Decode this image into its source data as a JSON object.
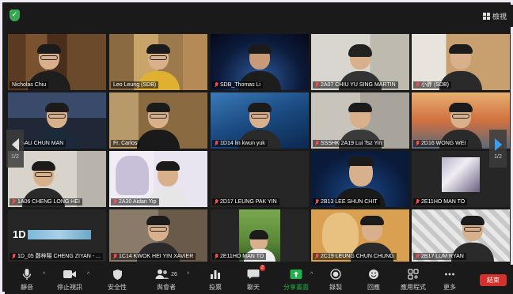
{
  "topbar": {
    "view_label": "檢視"
  },
  "pagination": {
    "left": "1/2",
    "right": "1/2"
  },
  "tiles": [
    {
      "name": "Nicholas Chiu",
      "muted": false
    },
    {
      "name": "Leo Leung (SDB)",
      "muted": false
    },
    {
      "name": "SDB_Thomas Li",
      "muted": true
    },
    {
      "name": "2A07 CHIU YU SING MARTIN",
      "muted": true
    },
    {
      "name": "小胖 (SDB)",
      "muted": true
    },
    {
      "name": "TSAU CHUN MAN",
      "muted": true
    },
    {
      "name": "Fr. Carlos",
      "muted": false
    },
    {
      "name": "1D14 lin kwun yuk",
      "muted": true
    },
    {
      "name": "SSSHK 2A19 Lui Tsz Yin",
      "muted": true
    },
    {
      "name": "2D16 WONG WEI",
      "muted": true
    },
    {
      "name": "1A06 CHENG LONG HEI",
      "muted": true
    },
    {
      "name": "2A30 Aidan Yip",
      "muted": true
    },
    {
      "name": "2D17 LEUNG PAK YIN",
      "muted": true
    },
    {
      "name": "2B13 LEE SHUN CHIT",
      "muted": true
    },
    {
      "name": "2E11HO MAN TO",
      "muted": true
    },
    {
      "name": "1D_05 鄭梓陽 CHENG ZIYAN - ...",
      "muted": true
    },
    {
      "name": "1C14 KWOK HEI YIN XAVIER",
      "muted": true
    },
    {
      "name": "2E11HO MAN TO",
      "muted": true
    },
    {
      "name": "2C19 LEUNG CHUN CHUNG",
      "muted": true
    },
    {
      "name": "2B17 LUM RYAN",
      "muted": true
    }
  ],
  "tile_text": {
    "censored_prefix": "1D"
  },
  "toolbar": {
    "mute": "靜音",
    "stop_video": "停止視訊",
    "security": "安全性",
    "participants": "與會者",
    "participants_count": "26",
    "polls": "投票",
    "chat": "聊天",
    "chat_badge": "2",
    "share_screen": "分享畫面",
    "record": "錄製",
    "reactions": "回應",
    "apps": "應用程式",
    "more": "更多",
    "end": "結束"
  },
  "colors": {
    "active_speaker": "#d9e23a",
    "share_green": "#22b24c",
    "end_red": "#d3312c",
    "muted_red": "#ff4a4a"
  }
}
